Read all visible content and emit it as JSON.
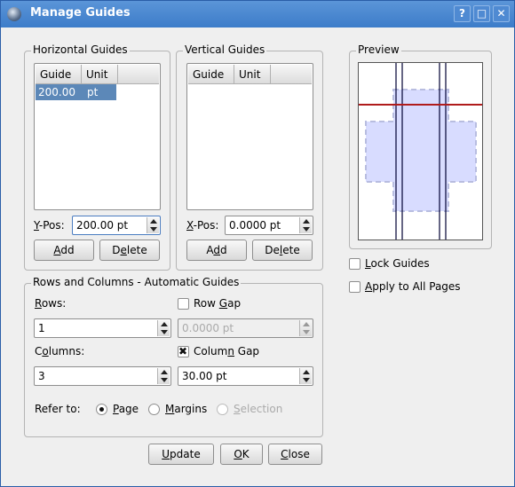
{
  "window": {
    "title": "Manage Guides",
    "help_btn": "?",
    "max_btn": "□",
    "close_btn": "✕"
  },
  "horizontal": {
    "title": "Horizontal Guides",
    "col_guide": "Guide",
    "col_unit": "Unit",
    "rows": [
      {
        "guide": "200.00",
        "unit": "pt"
      }
    ],
    "pos_label_u": "Y",
    "pos_label_rest": "-Pos:",
    "pos_value": "200.00 pt",
    "add_pre": "",
    "add_u": "A",
    "add_post": "dd",
    "del_pre": "D",
    "del_u": "e",
    "del_post": "lete"
  },
  "vertical": {
    "title": "Vertical Guides",
    "col_guide": "Guide",
    "col_unit": "Unit",
    "rows": [],
    "pos_label_u": "X",
    "pos_label_rest": "-Pos:",
    "pos_value": "0.0000 pt",
    "add_pre": "A",
    "add_u": "d",
    "add_post": "d",
    "del_pre": "De",
    "del_u": "l",
    "del_post": "ete"
  },
  "auto": {
    "title": "Rows and Columns - Automatic Guides",
    "rows_u": "R",
    "rows_rest": "ows:",
    "rows_value": "1",
    "rowgap_pre": "Row ",
    "rowgap_u": "G",
    "rowgap_post": "ap",
    "rowgap_checked": false,
    "rowgap_value": "0.0000 pt",
    "cols_pre": "C",
    "cols_u": "o",
    "cols_rest": "lumns:",
    "cols_value": "3",
    "colgap_pre": "Colum",
    "colgap_u": "n",
    "colgap_post": " Gap",
    "colgap_checked": true,
    "colgap_value": "30.00 pt",
    "refer_label": "Refer to:",
    "refer_options": [
      {
        "u": "P",
        "rest": "age",
        "selected": true,
        "enabled": true
      },
      {
        "u": "M",
        "rest": "argins",
        "selected": false,
        "enabled": true
      },
      {
        "u": "S",
        "rest": "election",
        "selected": false,
        "enabled": false
      }
    ]
  },
  "preview": {
    "title": "Preview",
    "guide_color": "#b01c1c",
    "column_color": "#000033",
    "shape_fill": "#d8dcff"
  },
  "options": {
    "lock_u": "L",
    "lock_rest": "ock Guides",
    "lock_checked": false,
    "apply_u": "A",
    "apply_rest": "pply to All Pages",
    "apply_checked": false
  },
  "buttons": {
    "update_u": "U",
    "update_rest": "pdate",
    "ok_u": "O",
    "ok_rest": "K",
    "close_u": "C",
    "close_rest": "lose"
  }
}
